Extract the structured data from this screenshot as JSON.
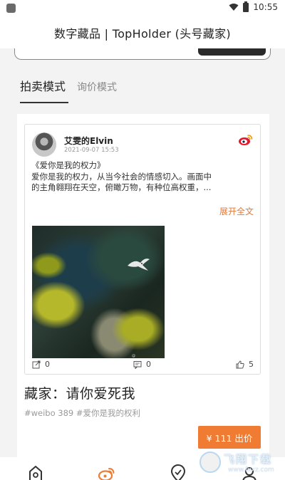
{
  "status_bar": {
    "time": "10:55"
  },
  "header": {
    "title": "数字藏品 | TopHolder (头号藏家)"
  },
  "tabs": [
    {
      "label": "拍卖模式",
      "active": true
    },
    {
      "label": "询价模式",
      "active": false
    }
  ],
  "post": {
    "author": "艾雯的Elvin",
    "date": "2021-09-07 15:53",
    "text_lines": [
      "《爱你是我的权力》",
      "爱你是我的权力，从当今社会的情感切入。画面中",
      "的主角翱翔在天空，俯瞰万物，有种位高权重，..."
    ],
    "expand_label": "展开全文",
    "share_count": "0",
    "comment_count": "0",
    "like_count": "5",
    "source_icon": "weibo-icon"
  },
  "item": {
    "title": "藏家：请你爱死我",
    "tags": "#weibo 389 #爱你是我的权利",
    "price_label": "¥ 111 出价"
  },
  "bottom_nav": [
    {
      "icon": "home-icon"
    },
    {
      "icon": "weibo-icon",
      "active": true
    },
    {
      "icon": "location-icon"
    },
    {
      "icon": "profile-icon"
    }
  ],
  "watermark": {
    "text": "飞翔下载",
    "url": "www.fxxz.com"
  },
  "colors": {
    "accent": "#f07c33",
    "weibo_red": "#e6162d",
    "expand_link": "#e07a3a"
  }
}
